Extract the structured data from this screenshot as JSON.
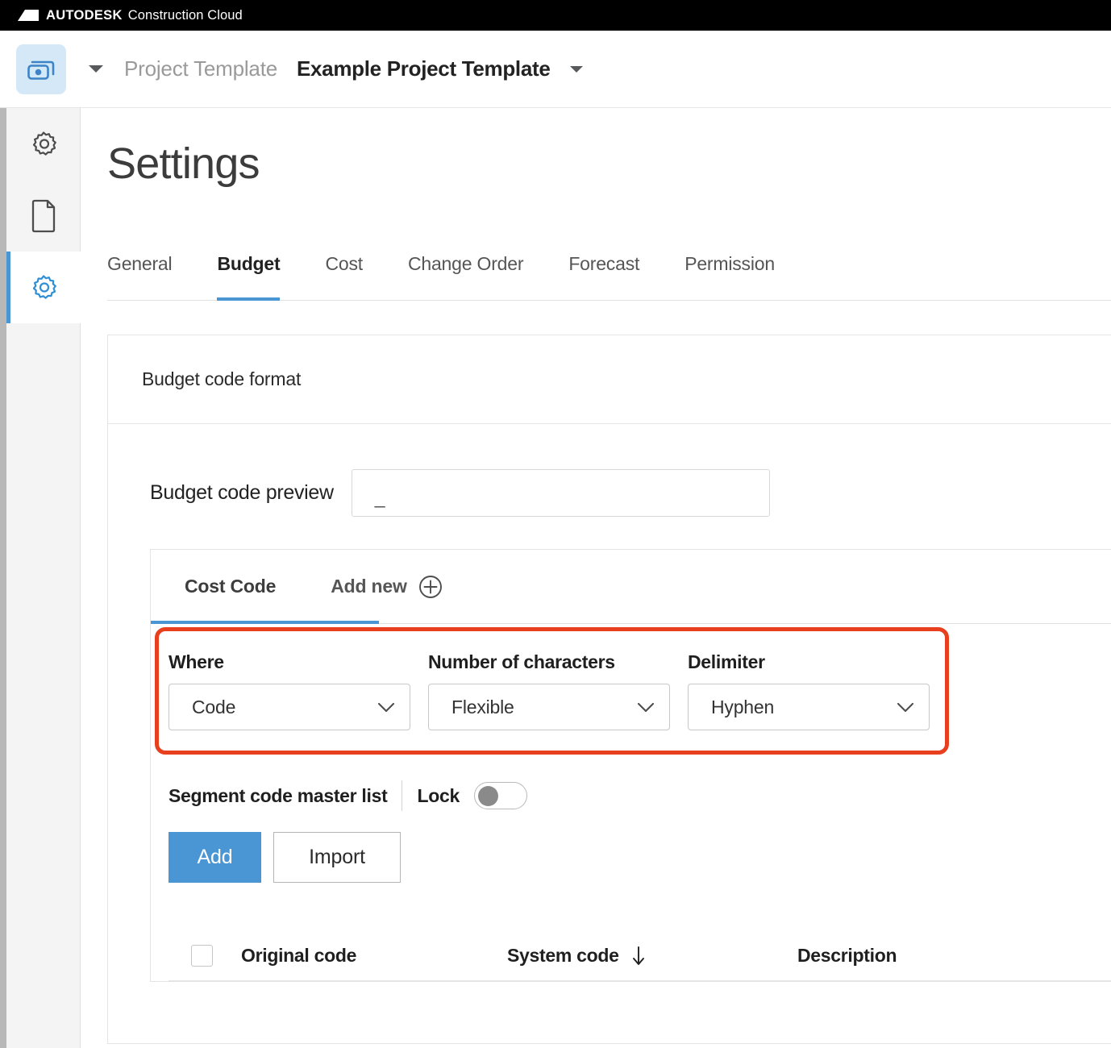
{
  "topbar": {
    "brand": "AUTODESK",
    "product": "Construction Cloud",
    "logo_icon": "autodesk-logo-icon"
  },
  "header": {
    "app_icon": "cost-management-icon",
    "crumb_caret_icon": "caret-down-icon",
    "breadcrumb_parent": "Project Template",
    "breadcrumb_current": "Example Project Template",
    "project_caret_icon": "caret-down-icon"
  },
  "rail": {
    "items": [
      {
        "icon": "gear-icon",
        "name": "settings-gear-top",
        "active": false
      },
      {
        "icon": "document-icon",
        "name": "document",
        "active": false
      },
      {
        "icon": "gear-icon",
        "name": "settings-gear-active",
        "active": true
      }
    ],
    "active_color": "#4a95d4"
  },
  "main": {
    "page_title": "Settings",
    "tabs": [
      {
        "label": "General",
        "active": false
      },
      {
        "label": "Budget",
        "active": true
      },
      {
        "label": "Cost",
        "active": false
      },
      {
        "label": "Change Order",
        "active": false
      },
      {
        "label": "Forecast",
        "active": false
      },
      {
        "label": "Permission",
        "active": false
      }
    ]
  },
  "card": {
    "header_title": "Budget code format",
    "preview": {
      "label": "Budget code preview",
      "value": "_",
      "placeholder": ""
    },
    "inner_tabs": [
      {
        "label": "Cost Code",
        "active": true
      },
      {
        "label": "Add new",
        "active": false,
        "icon": "plus-circle-icon"
      }
    ],
    "fields": [
      {
        "label": "Where",
        "value": "Code",
        "chevron_icon": "chevron-down-icon"
      },
      {
        "label": "Number of characters",
        "value": "Flexible",
        "chevron_icon": "chevron-down-icon"
      },
      {
        "label": "Delimiter",
        "value": "Hyphen",
        "chevron_icon": "chevron-down-icon"
      }
    ],
    "annotation": {
      "color": "#e8401f",
      "shape": "rounded-rectangle"
    },
    "master_list": {
      "title": "Segment code master list",
      "lock_label": "Lock",
      "lock_enabled": false
    },
    "buttons": {
      "add": "Add",
      "import": "Import",
      "add_color": "#4a95d4"
    },
    "table": {
      "select_all_checked": false,
      "columns": [
        {
          "label": "Original code",
          "sorted": false
        },
        {
          "label": "System code",
          "sorted": true,
          "sort_icon": "arrow-down-icon"
        },
        {
          "label": "Description",
          "sorted": false
        }
      ]
    }
  }
}
